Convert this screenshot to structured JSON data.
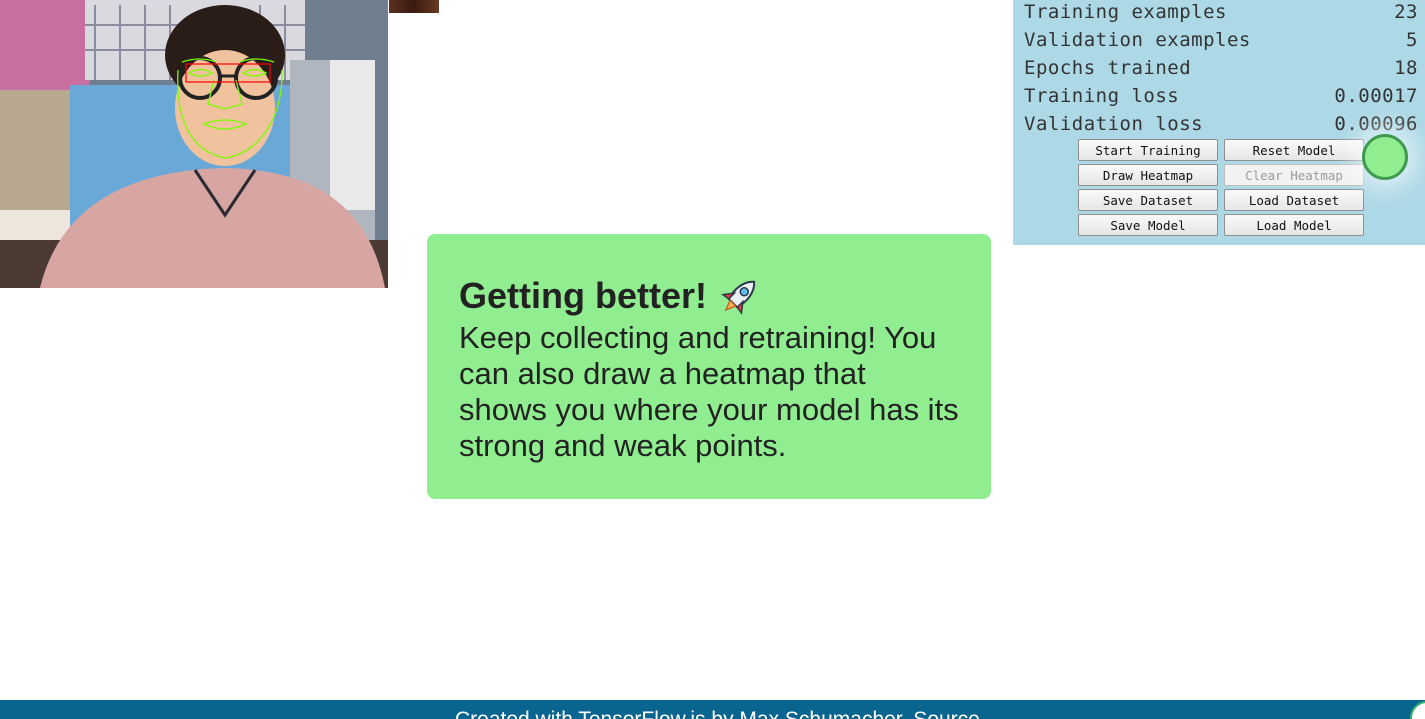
{
  "stats": [
    {
      "label": "Training examples",
      "value": "23"
    },
    {
      "label": "Validation examples",
      "value": "5"
    },
    {
      "label": "Epochs trained",
      "value": "18"
    },
    {
      "label": "Training loss",
      "value": "0.00017"
    },
    {
      "label": "Validation loss",
      "value": "0.00096"
    }
  ],
  "buttons": {
    "start_training": "Start Training",
    "reset_model": "Reset Model",
    "draw_heatmap": "Draw Heatmap",
    "clear_heatmap": "Clear Heatmap",
    "save_dataset": "Save Dataset",
    "load_dataset": "Load Dataset",
    "save_model": "Save Model",
    "load_model": "Load Model"
  },
  "card": {
    "title": "Getting better!",
    "title_icon": "rocket-icon",
    "body": "Keep collecting and retraining! You can also draw a heatmap that shows you where your model has its strong and weak points."
  },
  "footer": {
    "text": "Created with TensorFlow.js by Max Schumacher. Source"
  },
  "colors": {
    "panel_bg": "#add8e6",
    "card_bg": "#90ee90",
    "target_dot": "#90ee90",
    "footer_bg": "#09658f",
    "face_mesh": "#7cfc00",
    "eye_box": "#ff0000"
  }
}
